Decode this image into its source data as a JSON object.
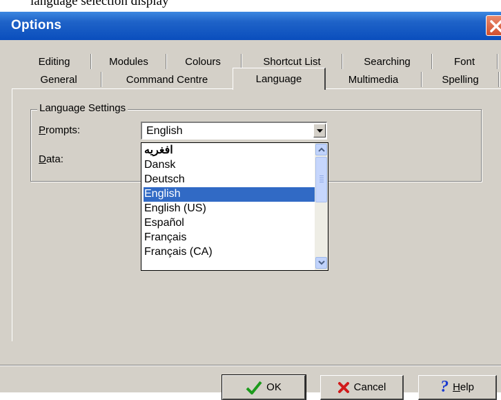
{
  "top_strip_text": "language selection display",
  "window": {
    "title": "Options"
  },
  "tabs_row1": [
    {
      "label": "Editing"
    },
    {
      "label": "Modules"
    },
    {
      "label": "Colours"
    },
    {
      "label": "Shortcut List"
    },
    {
      "label": "Searching"
    },
    {
      "label": "Font"
    }
  ],
  "tabs_row2": [
    {
      "label": "General"
    },
    {
      "label": "Command Centre"
    },
    {
      "label": "Language"
    },
    {
      "label": "Multimedia"
    },
    {
      "label": "Spelling"
    }
  ],
  "active_tab": "Language",
  "group": {
    "title": "Language Settings",
    "prompts_label": "rompts:",
    "prompts_mnemonic": "P",
    "data_label": "ata:",
    "data_mnemonic": "D"
  },
  "prompts_combo": {
    "value": "English"
  },
  "dropdown": {
    "options": [
      "افغريه",
      "Dansk",
      "Deutsch",
      "English",
      "English (US)",
      "Español",
      "Français",
      "Français (CA)"
    ],
    "selected_index": 3
  },
  "buttons": {
    "ok": "OK",
    "cancel": "Cancel",
    "help_mnemonic": "H",
    "help_rest": "elp"
  },
  "colors": {
    "titlebar": "#0a4ebd",
    "face": "#d4d0c8",
    "selection": "#316ac5",
    "close": "#d2502e"
  },
  "icons": {
    "ok": "green-check-icon",
    "cancel": "red-x-icon",
    "help": "blue-question-icon"
  }
}
